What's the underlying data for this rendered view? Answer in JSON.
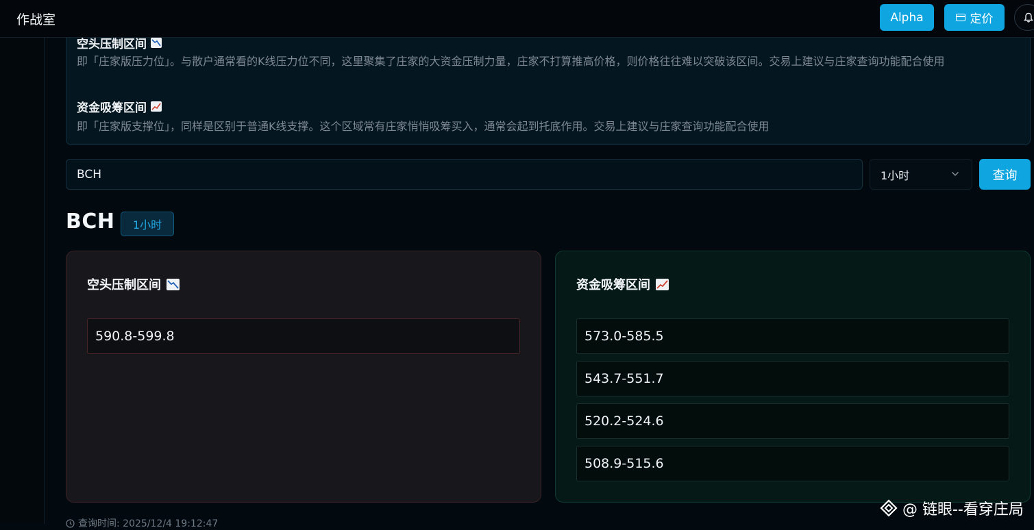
{
  "header": {
    "app_title": "作战室",
    "alpha_label": "Alpha",
    "pricing_label": "定价"
  },
  "info": {
    "resistance_title": "空头压制区间",
    "resistance_desc": "即「庄家版压力位」。与散户通常看的K线压力位不同，这里聚集了庄家的大资金压制力量，庄家不打算推高价格，则价格往往难以突破该区间。交易上建议与庄家查询功能配合使用",
    "support_title": "资金吸筹区间",
    "support_desc": "即「庄家版支撑位」，同样是区别于普通K线支撑。这个区域常有庄家悄悄吸筹买入，通常会起到托底作用。交易上建议与庄家查询功能配合使用"
  },
  "search": {
    "value": "BCH",
    "interval": "1小时",
    "query_label": "查询"
  },
  "result": {
    "symbol": "BCH",
    "interval_badge": "1小时",
    "short_panel": {
      "title": "空头压制区间",
      "ranges": [
        "590.8-599.8"
      ]
    },
    "long_panel": {
      "title": "资金吸筹区间",
      "ranges": [
        "573.0-585.5",
        "543.7-551.7",
        "520.2-524.6",
        "508.9-515.6"
      ]
    },
    "query_time": "查询时间: 2025/12/4 19:12:47"
  },
  "watermark": "@ 链眼--看穿庄局",
  "colors": {
    "accent": "#0ea5e0",
    "background": "#020a10",
    "short_panel": "#17171c",
    "long_panel": "#051916"
  },
  "icons": [
    "card-icon",
    "bell-icon",
    "chart-decreasing-icon",
    "chart-increasing-icon",
    "chevron-down-icon",
    "clock-icon",
    "diamond-logo-icon"
  ]
}
